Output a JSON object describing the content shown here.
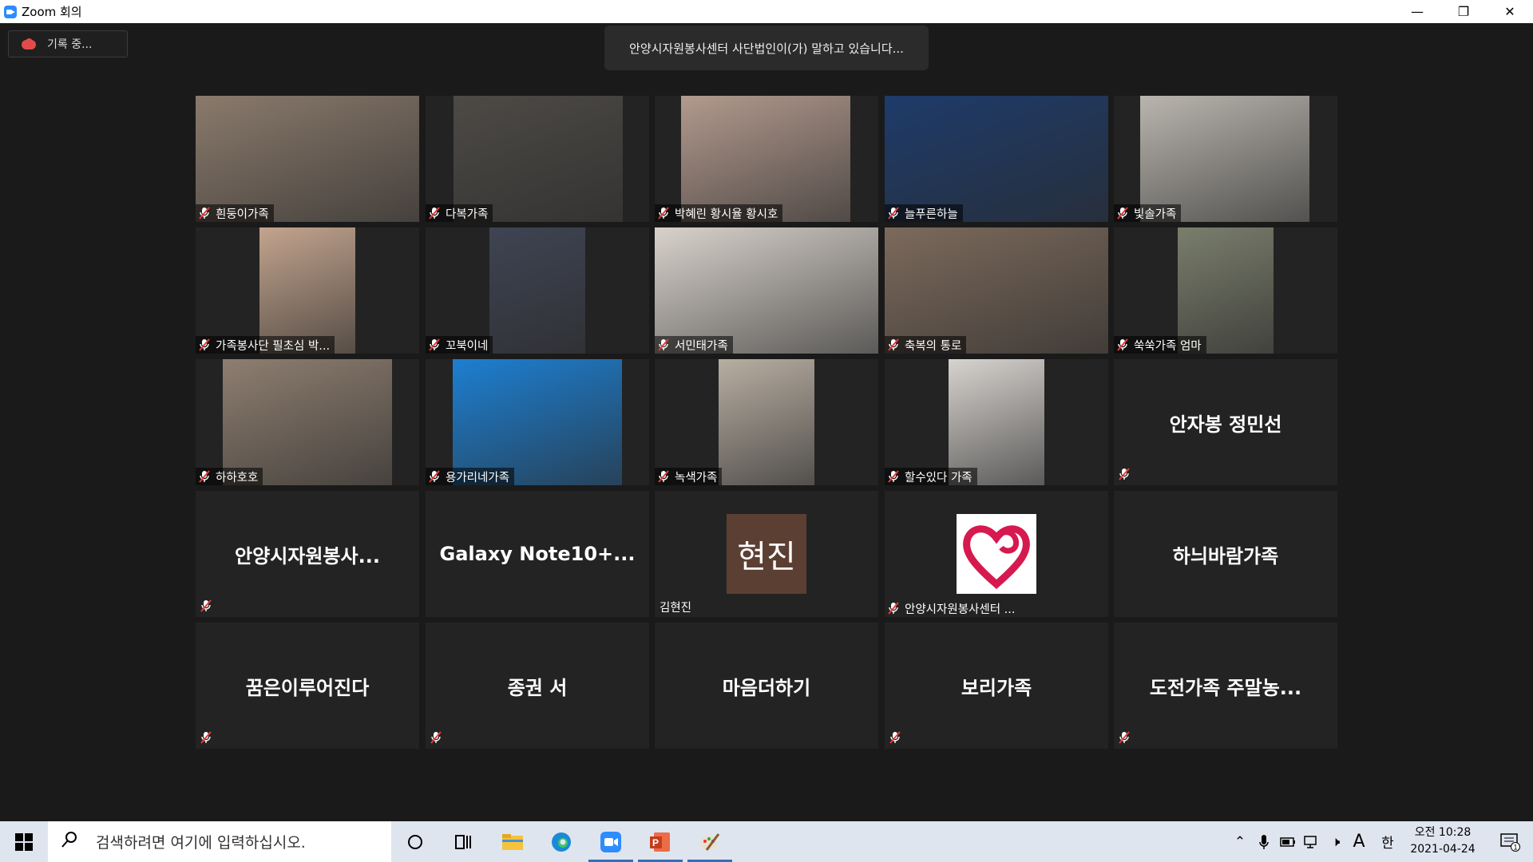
{
  "window": {
    "title": "Zoom 회의",
    "min_icon": "minimize-icon",
    "max_icon": "restore-icon",
    "close_icon": "close-icon"
  },
  "recording": {
    "label": "기록 중..."
  },
  "speaking": {
    "text": "안양시자원봉사센터 사단법인이(가) 말하고 있습니다..."
  },
  "participants": [
    {
      "name": "흰둥이가족",
      "kind": "video",
      "bg": "#8a7a6c"
    },
    {
      "name": "다복가족",
      "kind": "video",
      "bg": "#4d4a46"
    },
    {
      "name": "박혜린 황시율 황시호",
      "kind": "video",
      "bg": "#b29a8e"
    },
    {
      "name": "늘푸른하늘",
      "kind": "video",
      "bg": "#1e3b6a"
    },
    {
      "name": "빛솔가족",
      "kind": "video",
      "bg": "#b9b5ae"
    },
    {
      "name": "가족봉사단 필초심 박...",
      "kind": "video",
      "bg": "#c3a48e"
    },
    {
      "name": "꼬북이네",
      "kind": "video",
      "bg": "#3f4453"
    },
    {
      "name": "서민태가족",
      "kind": "video",
      "bg": "#d8d2cb"
    },
    {
      "name": "축복의 통로",
      "kind": "video",
      "bg": "#7c6a5c"
    },
    {
      "name": "쑥쑥가족 엄마",
      "kind": "video",
      "bg": "#7a7e6c"
    },
    {
      "name": "하하호호",
      "kind": "video",
      "bg": "#8e7e70"
    },
    {
      "name": "용가리네가족",
      "kind": "video",
      "bg": "#1d7fd1"
    },
    {
      "name": "녹색가족",
      "kind": "video",
      "bg": "#b8aea2"
    },
    {
      "name": "할수있다 가족",
      "kind": "video",
      "bg": "#d7d3cf"
    },
    {
      "name": "안자봉 정민선",
      "kind": "name",
      "muted": true
    },
    {
      "name": "안양시자원봉사...",
      "kind": "name",
      "muted": true
    },
    {
      "name": "Galaxy  Note10+...",
      "kind": "name",
      "muted": false
    },
    {
      "name": "김현진",
      "kind": "avatar-text",
      "avatar": "현진",
      "muted": false
    },
    {
      "name": "안양시자원봉사센터 ...",
      "kind": "avatar-logo",
      "muted": true
    },
    {
      "name": "하늬바람가족",
      "kind": "name",
      "muted": false
    },
    {
      "name": "꿈은이루어진다",
      "kind": "name",
      "muted": true
    },
    {
      "name": "종권 서",
      "kind": "name",
      "muted": true
    },
    {
      "name": "마음더하기",
      "kind": "name",
      "muted": false
    },
    {
      "name": "보리가족",
      "kind": "name",
      "muted": true
    },
    {
      "name": "도전가족 주말농...",
      "kind": "name",
      "muted": true
    }
  ],
  "taskbar": {
    "search_placeholder": "검색하려면 여기에 입력하십시오.",
    "apps": [
      "cortana-icon",
      "task-view-icon",
      "file-explorer-icon",
      "edge-icon",
      "zoom-icon",
      "powerpoint-icon",
      "paint-icon"
    ],
    "ime_letter": "A",
    "ime_lang": "한",
    "clock_time": "오전 10:28",
    "clock_date": "2021-04-24",
    "notification_count": "1"
  }
}
